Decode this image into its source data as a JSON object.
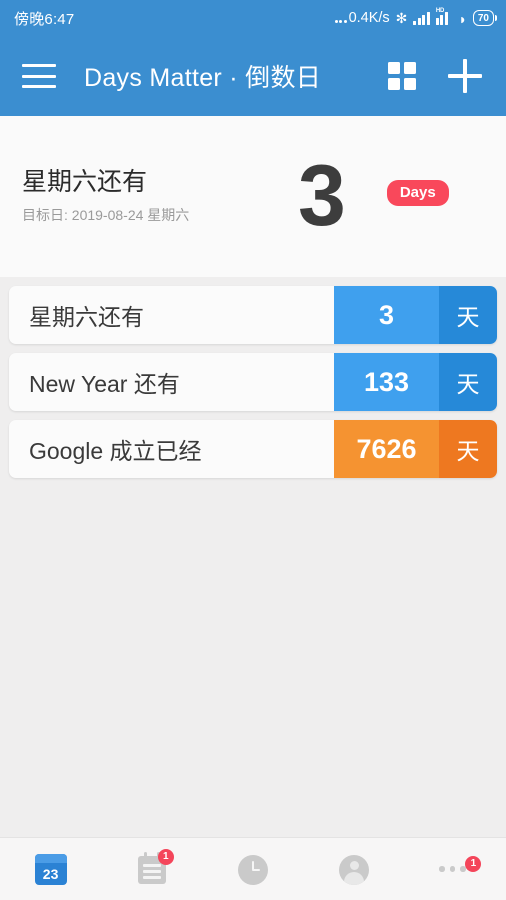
{
  "status_bar": {
    "time": "傍晚6:47",
    "net_speed": "0.4K/s",
    "bluetooth_icon": "bluetooth-icon",
    "signal_icon": "signal-bars-icon",
    "hd_label": "HD",
    "wifi_icon": "wifi-icon",
    "battery_level": "70"
  },
  "appbar": {
    "menu_icon": "hamburger-menu-icon",
    "title": "Days Matter · 倒数日",
    "grid_icon": "grid-view-icon",
    "add_icon": "add-plus-icon"
  },
  "hero": {
    "title": "星期六还有",
    "subtitle": "目标日: 2019-08-24 星期六",
    "count": "3",
    "badge_label": "Days",
    "badge_color": "#f9485b"
  },
  "list": {
    "items": [
      {
        "title": "星期六还有",
        "number": "3",
        "unit": "天",
        "color": "blue",
        "num_color": "#3fa0ee",
        "unit_color": "#2689d8"
      },
      {
        "title": "New Year 还有",
        "number": "133",
        "unit": "天",
        "color": "blue",
        "num_color": "#3fa0ee",
        "unit_color": "#2689d8"
      },
      {
        "title": "Google 成立已经",
        "number": "7626",
        "unit": "天",
        "color": "orange",
        "num_color": "#f59331",
        "unit_color": "#ee7820"
      }
    ]
  },
  "bottom_nav": {
    "items": [
      {
        "icon": "calendar-icon",
        "day_number": "23",
        "active": true,
        "badge": ""
      },
      {
        "icon": "notepad-icon",
        "active": false,
        "badge": "1"
      },
      {
        "icon": "clock-icon",
        "active": false,
        "badge": ""
      },
      {
        "icon": "profile-avatar-icon",
        "active": false,
        "badge": ""
      },
      {
        "icon": "more-dots-icon",
        "active": false,
        "badge": "1"
      }
    ]
  },
  "theme": {
    "primary": "#3b8ed0",
    "page_bg": "#efeeee",
    "card_bg": "#fbfbfb",
    "badge_red": "#f4455a"
  }
}
